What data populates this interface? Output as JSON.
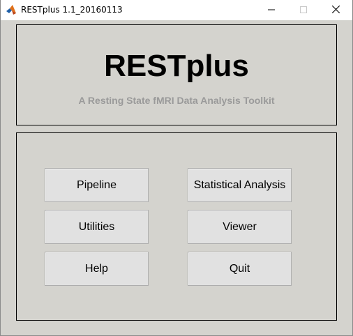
{
  "window": {
    "title": "RESTplus 1.1_20160113",
    "controls": {
      "minimize_icon": "minimize-icon",
      "maximize_icon": "maximize-icon",
      "close_icon": "close-icon"
    }
  },
  "header": {
    "title": "RESTplus",
    "subtitle": "A Resting State fMRI Data Analysis Toolkit"
  },
  "buttons": {
    "pipeline": "Pipeline",
    "statistical_analysis": "Statistical Analysis",
    "utilities": "Utilities",
    "viewer": "Viewer",
    "help": "Help",
    "quit": "Quit"
  },
  "colors": {
    "background": "#d4d3ce",
    "subtitle": "#9a9a9a",
    "button_face": "#e1e1e1",
    "titlebar": "#ffffff"
  }
}
